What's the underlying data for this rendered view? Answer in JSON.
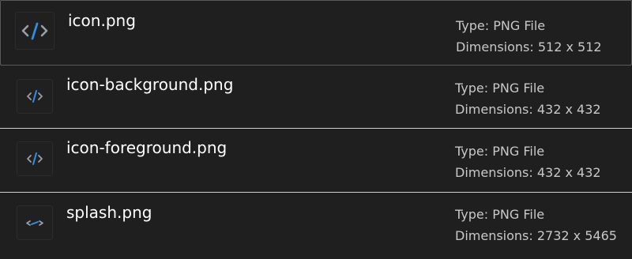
{
  "files": [
    {
      "name": "icon.png",
      "type": "Type: PNG File",
      "dimensions": "Dimensions: 512 x 512",
      "icon": "code-brackets-icon"
    },
    {
      "name": "icon-background.png",
      "type": "Type: PNG File",
      "dimensions": "Dimensions: 432 x 432",
      "icon": "code-brackets-icon"
    },
    {
      "name": "icon-foreground.png",
      "type": "Type: PNG File",
      "dimensions": "Dimensions: 432 x 432",
      "icon": "code-brackets-icon"
    },
    {
      "name": "splash.png",
      "type": "Type: PNG File",
      "dimensions": "Dimensions: 2732 x 5465",
      "icon": "code-brackets-icon"
    }
  ],
  "colors": {
    "bracket": "#9a9fa8",
    "slash": "#2f8fe6",
    "background": "#1f1f1f"
  }
}
